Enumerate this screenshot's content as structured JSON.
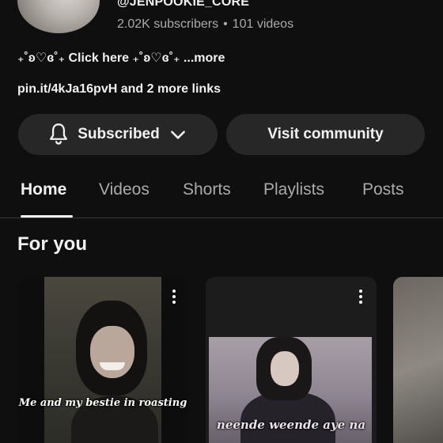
{
  "channel": {
    "handle": "@JENPOOKIE_CORE",
    "subscribers": "2.02K subscribers",
    "separator": "•",
    "videos": "101 videos",
    "description": "₊˚ʚ♡ɞ˚₊ Click here ₊˚ʚ♡ɞ˚₊",
    "more": "...more",
    "links": "pin.it/4kJa16pvH and 2 more links"
  },
  "actions": {
    "subscribed_label": "Subscribed",
    "visit_label": "Visit community"
  },
  "tabs": [
    {
      "label": "Home",
      "active": true
    },
    {
      "label": "Videos",
      "active": false
    },
    {
      "label": "Shorts",
      "active": false
    },
    {
      "label": "Playlists",
      "active": false
    },
    {
      "label": "Posts",
      "active": false
    }
  ],
  "section": {
    "title": "For you"
  },
  "shorts": [
    {
      "caption": "Me and my bestie in roasting"
    },
    {
      "caption": "neende weende aye na"
    },
    {
      "caption": ""
    }
  ],
  "icons": {
    "bell": "bell-icon",
    "chevron": "chevron-down-icon",
    "menu": "more-vert-icon"
  },
  "colors": {
    "background": "#0f0f0f",
    "button": "#272727",
    "text_primary": "#f1f1f1",
    "text_secondary": "#aaaaaa"
  }
}
